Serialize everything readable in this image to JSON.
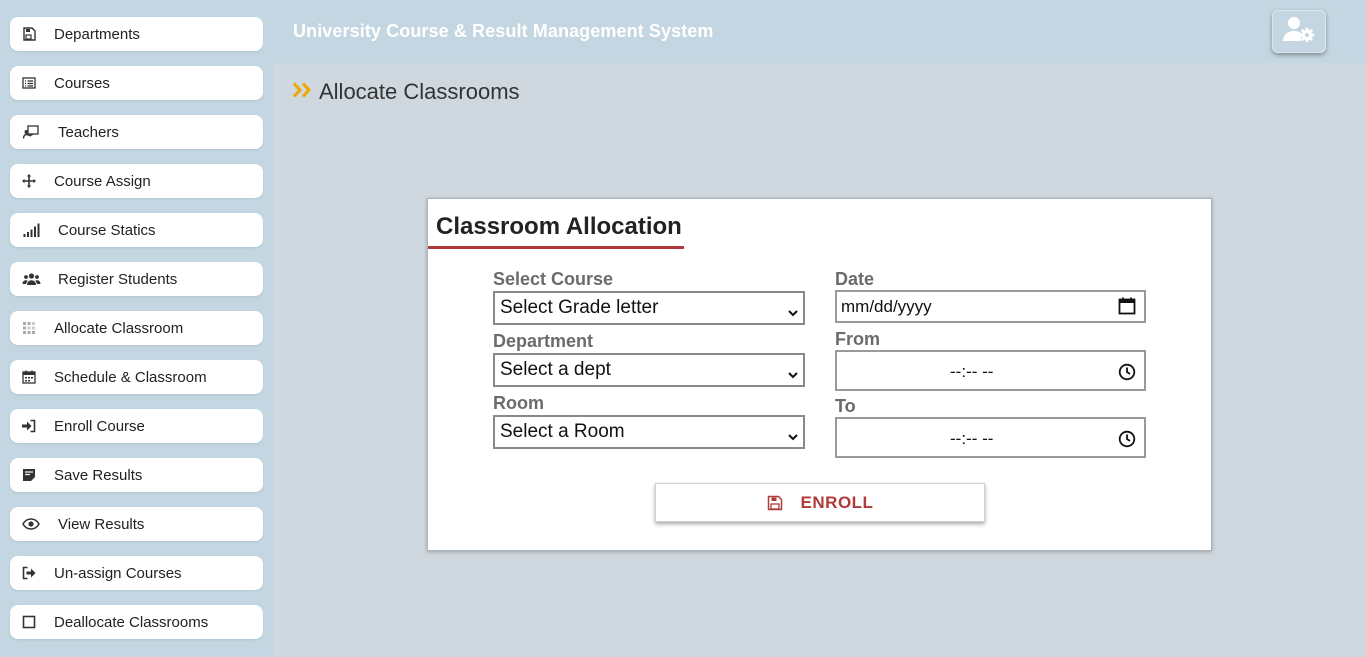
{
  "app": {
    "title": "University Course & Result Management System"
  },
  "sidebar": {
    "items": [
      {
        "label": "Departments",
        "icon": "save-icon"
      },
      {
        "label": "Courses",
        "icon": "list-icon"
      },
      {
        "label": "Teachers",
        "icon": "teacher-icon"
      },
      {
        "label": "Course Assign",
        "icon": "move-icon"
      },
      {
        "label": "Course Statics",
        "icon": "signal-icon"
      },
      {
        "label": "Register Students",
        "icon": "users-icon"
      },
      {
        "label": "Allocate Classroom",
        "icon": "grid-icon"
      },
      {
        "label": "Schedule & Classroom",
        "icon": "calendar-icon"
      },
      {
        "label": "Enroll Course",
        "icon": "sign-in-icon"
      },
      {
        "label": "Save Results",
        "icon": "document-icon"
      },
      {
        "label": "View Results",
        "icon": "eye-icon"
      },
      {
        "label": "Un-assign Courses",
        "icon": "sign-out-icon"
      },
      {
        "label": "Deallocate Classrooms",
        "icon": "square-icon"
      }
    ]
  },
  "header": {
    "user_button_icon": "user-gear-icon"
  },
  "page": {
    "heading": "Allocate Classrooms",
    "heading_icon": "double-chevron-right-icon",
    "accent": "#f0a500"
  },
  "form": {
    "title": "Classroom Allocation",
    "accent": "#b03a3a",
    "course_label": "Select Course",
    "course_value": "Select Grade letter",
    "department_label": "Department",
    "department_value": "Select a dept",
    "room_label": "Room",
    "room_value": "Select a Room",
    "date_label": "Date",
    "date_value": "mm/dd/yyyy",
    "from_label": "From",
    "from_value": "--:-- --",
    "to_label": "To",
    "to_value": "--:-- --",
    "submit_label": "ENROLL"
  }
}
